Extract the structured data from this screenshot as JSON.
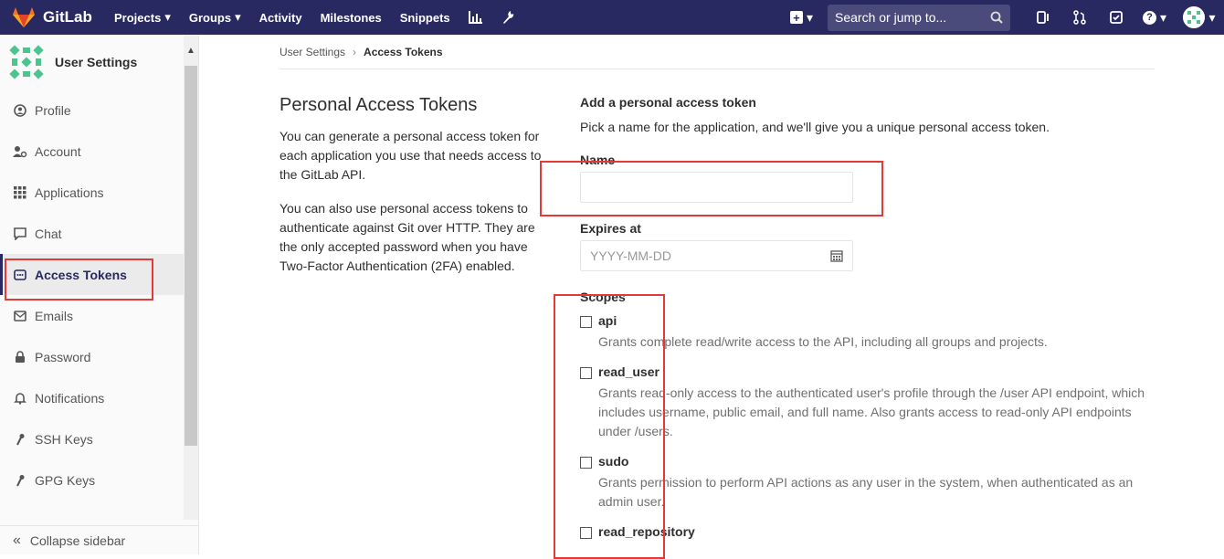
{
  "navbar": {
    "brand": "GitLab",
    "links": [
      "Projects",
      "Groups",
      "Activity",
      "Milestones",
      "Snippets"
    ],
    "search_placeholder": "Search or jump to..."
  },
  "sidebar": {
    "title": "User Settings",
    "items": [
      {
        "label": "Profile",
        "icon": "profile-icon"
      },
      {
        "label": "Account",
        "icon": "account-icon"
      },
      {
        "label": "Applications",
        "icon": "applications-icon"
      },
      {
        "label": "Chat",
        "icon": "chat-icon"
      },
      {
        "label": "Access Tokens",
        "icon": "token-icon",
        "active": true
      },
      {
        "label": "Emails",
        "icon": "mail-icon"
      },
      {
        "label": "Password",
        "icon": "lock-icon"
      },
      {
        "label": "Notifications",
        "icon": "bell-icon"
      },
      {
        "label": "SSH Keys",
        "icon": "key-icon"
      },
      {
        "label": "GPG Keys",
        "icon": "key-icon"
      }
    ],
    "collapse": "Collapse sidebar"
  },
  "breadcrumbs": {
    "root": "User Settings",
    "current": "Access Tokens"
  },
  "intro": {
    "title": "Personal Access Tokens",
    "p1": "You can generate a personal access token for each application you use that needs access to the GitLab API.",
    "p2": "You can also use personal access tokens to authenticate against Git over HTTP. They are the only accepted password when you have Two-Factor Authentication (2FA) enabled."
  },
  "form": {
    "heading": "Add a personal access token",
    "lead": "Pick a name for the application, and we'll give you a unique personal access token.",
    "name_label": "Name",
    "name_value": "",
    "expires_label": "Expires at",
    "expires_placeholder": "YYYY-MM-DD",
    "scopes_label": "Scopes",
    "scopes": [
      {
        "name": "api",
        "desc": "Grants complete read/write access to the API, including all groups and projects."
      },
      {
        "name": "read_user",
        "desc": "Grants read-only access to the authenticated user's profile through the /user API endpoint, which includes username, public email, and full name. Also grants access to read-only API endpoints under /users."
      },
      {
        "name": "sudo",
        "desc": "Grants permission to perform API actions as any user in the system, when authenticated as an admin user."
      },
      {
        "name": "read_repository",
        "desc": ""
      }
    ]
  },
  "colors": {
    "navbar": "#292961",
    "highlight": "#e53935"
  }
}
